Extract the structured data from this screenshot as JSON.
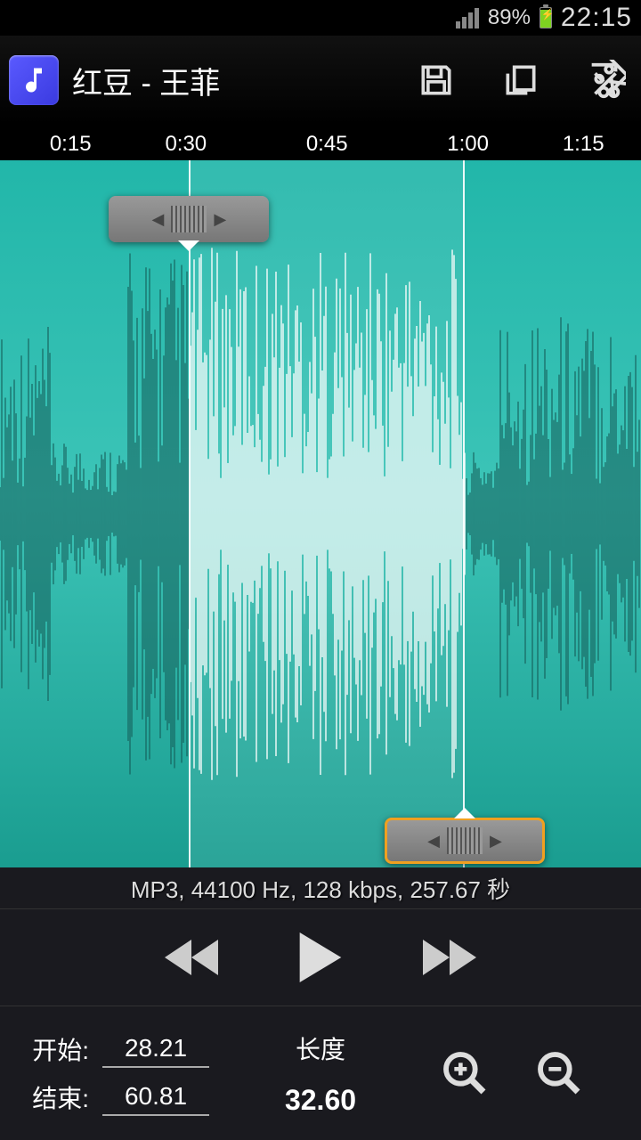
{
  "status": {
    "battery_pct": "89%",
    "time": "22:15"
  },
  "header": {
    "title": "红豆 - 王菲"
  },
  "timeline": {
    "labels": [
      "0:15",
      "0:30",
      "0:45",
      "1:00",
      "1:15"
    ],
    "positions_pct": [
      11,
      29,
      51,
      73,
      91
    ]
  },
  "selection": {
    "start_pct": 29.5,
    "end_pct": 72.5
  },
  "file_info": "MP3, 44100 Hz, 128 kbps, 257.67 秒",
  "controls": {
    "start_label": "开始:",
    "start_value": "28.21",
    "end_label": "结束:",
    "end_value": "60.81",
    "length_label": "长度",
    "length_value": "32.60"
  }
}
